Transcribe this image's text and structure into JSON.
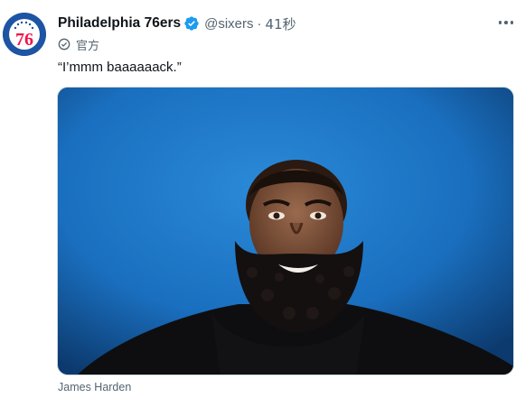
{
  "tweet": {
    "display_name": "Philadelphia 76ers",
    "handle": "@sixers",
    "separator": "·",
    "time": "41秒",
    "official_label": "官方",
    "text": "“I’mmm baaaaaack.”",
    "media_caption": "James Harden",
    "avatar_text": "76"
  },
  "icons": {
    "verified": "verified-badge-icon",
    "official": "official-check-icon",
    "more": "more-options-icon"
  },
  "colors": {
    "brand_blue": "#1d54a4",
    "verified_blue": "#1d9bf0",
    "secondary_text": "#536471",
    "avatar_red": "#ed174c"
  }
}
